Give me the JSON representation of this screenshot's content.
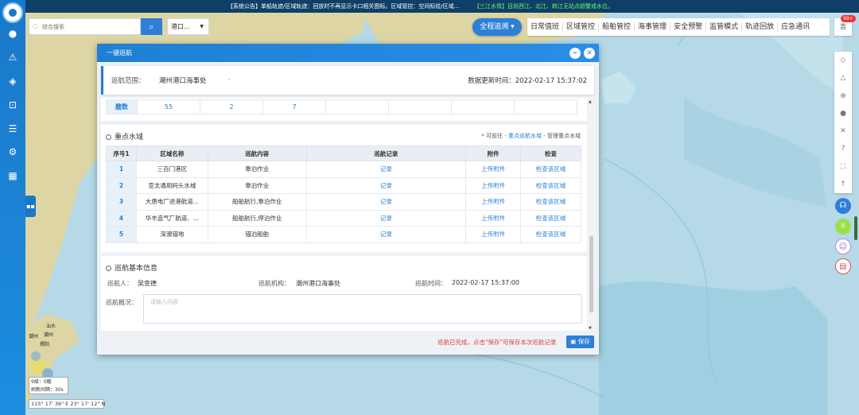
{
  "notice_bar": {
    "announcement": "【系统公告】单船轨迹/区域轨迹：回放时不再显示卡口相关图标。区域管控：空间标绘/区域...",
    "water_level": "【三江水情】目前西江、北江、韩江无站点超警戒水位。"
  },
  "search": {
    "placeholder": "综合搜索"
  },
  "port_select": {
    "value": "港口..."
  },
  "panorama_button": "全程追溯",
  "top_menu": [
    "日常值班",
    "区域管控",
    "船舶管控",
    "海事管理",
    "安全预警",
    "监管模式",
    "轨迹回放",
    "应急通讯"
  ],
  "user": {
    "label": "吉",
    "badge": "99+"
  },
  "map": {
    "labels": [
      "潮州",
      "汕头",
      "潮州",
      "揭阳"
    ],
    "scale": {
      "level": "9级：0艘",
      "refresh": "刷新间隔：30s"
    },
    "coordinates": "115° 17' 36\" E   23° 17' 12\" N"
  },
  "dialog": {
    "title": "一键巡航",
    "scope_label": "巡航范围：",
    "scope_value": "潮州港口海事处",
    "update_time": "数据更新时间：2022-02-17 15:37:02",
    "stats": [
      "艘数",
      "55",
      "2",
      "7",
      "",
      "",
      "",
      ""
    ],
    "water": {
      "title": "重点水域",
      "hint_prefix": "* 可前往 - ",
      "hint_link": "重点巡航水域",
      "hint_suffix": " - 管理重点水域",
      "headers": [
        "序号1",
        "区域名称",
        "巡航内容",
        "巡航记录",
        "附件",
        "检查"
      ],
      "rows": [
        {
          "no": "1",
          "name": "三百门港区",
          "content": "靠泊作业",
          "record": "记录",
          "attach": "上传附件",
          "check": "检查该区域"
        },
        {
          "no": "2",
          "name": "亚太通用码头水域",
          "content": "靠泊作业",
          "record": "记录",
          "attach": "上传附件",
          "check": "检查该区域"
        },
        {
          "no": "3",
          "name": "大唐电厂进港航道...",
          "content": "船舶航行,靠泊作业",
          "record": "记录",
          "attach": "上传附件",
          "check": "检查该区域"
        },
        {
          "no": "4",
          "name": "华丰造气厂航道、...",
          "content": "船舶航行,停泊作业",
          "record": "记录",
          "attach": "上传附件",
          "check": "检查该区域"
        },
        {
          "no": "5",
          "name": "深澳锚地",
          "content": "锚泊船舶",
          "record": "记录",
          "attach": "上传附件",
          "check": "检查该区域"
        }
      ]
    },
    "info": {
      "title": "巡航基本信息",
      "cruiser_label": "巡航人：",
      "cruiser": "吴金德",
      "org_label": "巡航机构：",
      "org": "潮州港口海事处",
      "time_label": "巡航时间：",
      "time": "2022-02-17 15:37:00",
      "remark_label": "巡航概况：",
      "remark_placeholder": "请输入内容"
    },
    "footer_msg": "巡航已完成，点击\"保存\"可保存本次巡航记录",
    "save_label": "保存"
  },
  "colors": {
    "primary": "#2e7fd6",
    "sidebar": "#1a78c9",
    "sea": "#b5d9e6",
    "land": "#ddd6a4",
    "warning": "#e23a3a"
  }
}
